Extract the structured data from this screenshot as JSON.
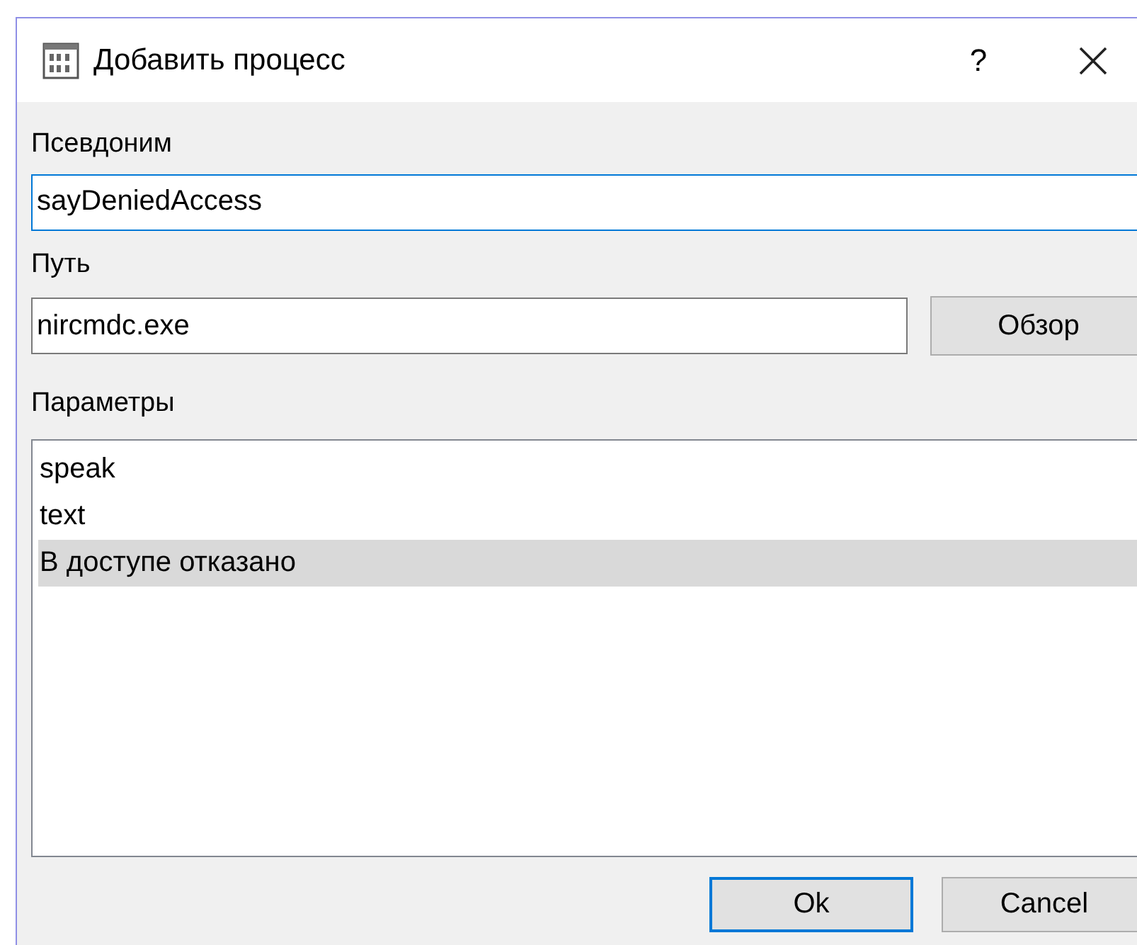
{
  "window": {
    "title": "Добавить процесс",
    "help": "?"
  },
  "alias": {
    "label": "Псевдоним",
    "value": "sayDeniedAccess",
    "focused": true
  },
  "path": {
    "label": "Путь",
    "value": "nircmdc.exe",
    "focused": false,
    "browse": "Обзор"
  },
  "parameters": {
    "label": "Параметры",
    "items": [
      {
        "text": "speak",
        "selected": false
      },
      {
        "text": "text",
        "selected": false
      },
      {
        "text": "В доступе отказано",
        "selected": true
      }
    ]
  },
  "buttons": [
    {
      "label": "Ok",
      "default": true
    },
    {
      "label": "Cancel",
      "default": false
    }
  ]
}
